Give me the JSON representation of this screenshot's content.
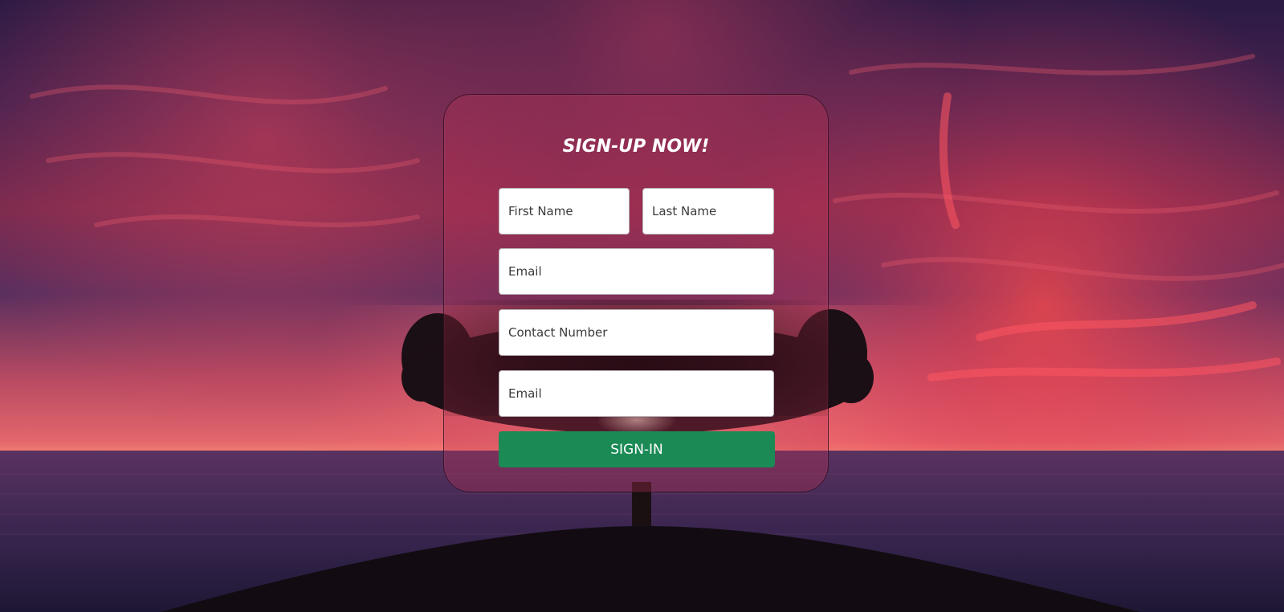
{
  "form": {
    "title": "SIGN-UP NOW!",
    "first_name_placeholder": "First Name",
    "last_name_placeholder": "Last Name",
    "email_placeholder": "Email",
    "contact_placeholder": "Contact Number",
    "email2_placeholder": "Email",
    "submit_label": "SIGN-IN"
  },
  "colors": {
    "submit_button": "#1b8a55",
    "field_background": "#ffffff",
    "title_text": "#ffffff"
  },
  "background": {
    "icon": "sunset-tree-landscape"
  }
}
